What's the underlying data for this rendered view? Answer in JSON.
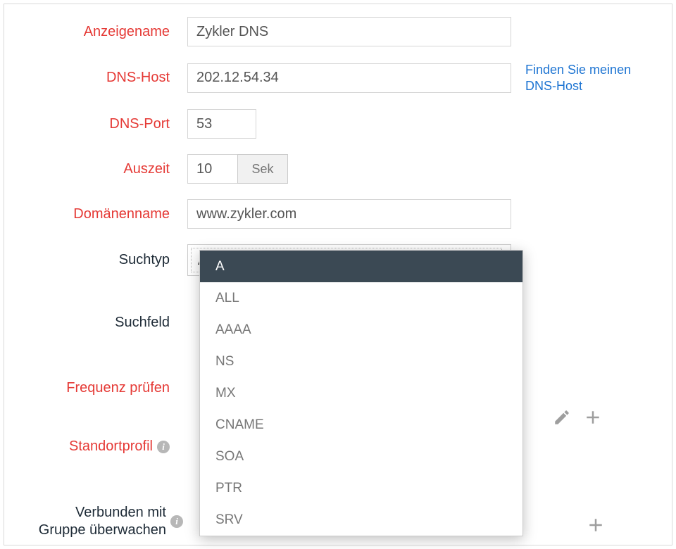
{
  "form": {
    "display_name_label": "Anzeigename",
    "display_name_value": "Zykler DNS",
    "dns_host_label": "DNS-Host",
    "dns_host_value": "202.12.54.34",
    "find_host_link": "Finden Sie meinen DNS-Host",
    "dns_port_label": "DNS-Port",
    "dns_port_value": "53",
    "timeout_label": "Auszeit",
    "timeout_value": "10",
    "timeout_suffix": "Sek",
    "domain_name_label": "Domänenname",
    "domain_name_value": "www.zykler.com",
    "lookup_type_label": "Suchtyp",
    "lookup_type_value": "A",
    "search_field_label": "Suchfeld",
    "check_frequency_label": "Frequenz prüfen",
    "location_profile_label": "Standortprofil",
    "monitor_group_label_line1": "Verbunden mit",
    "monitor_group_label_line2": "Gruppe überwachen"
  },
  "dropdown": {
    "options": [
      "A",
      "ALL",
      "AAAA",
      "NS",
      "MX",
      "CNAME",
      "SOA",
      "PTR",
      "SRV"
    ],
    "selected": "A"
  },
  "icons": {
    "info": "i",
    "edit": "edit-icon",
    "add": "plus-icon"
  }
}
